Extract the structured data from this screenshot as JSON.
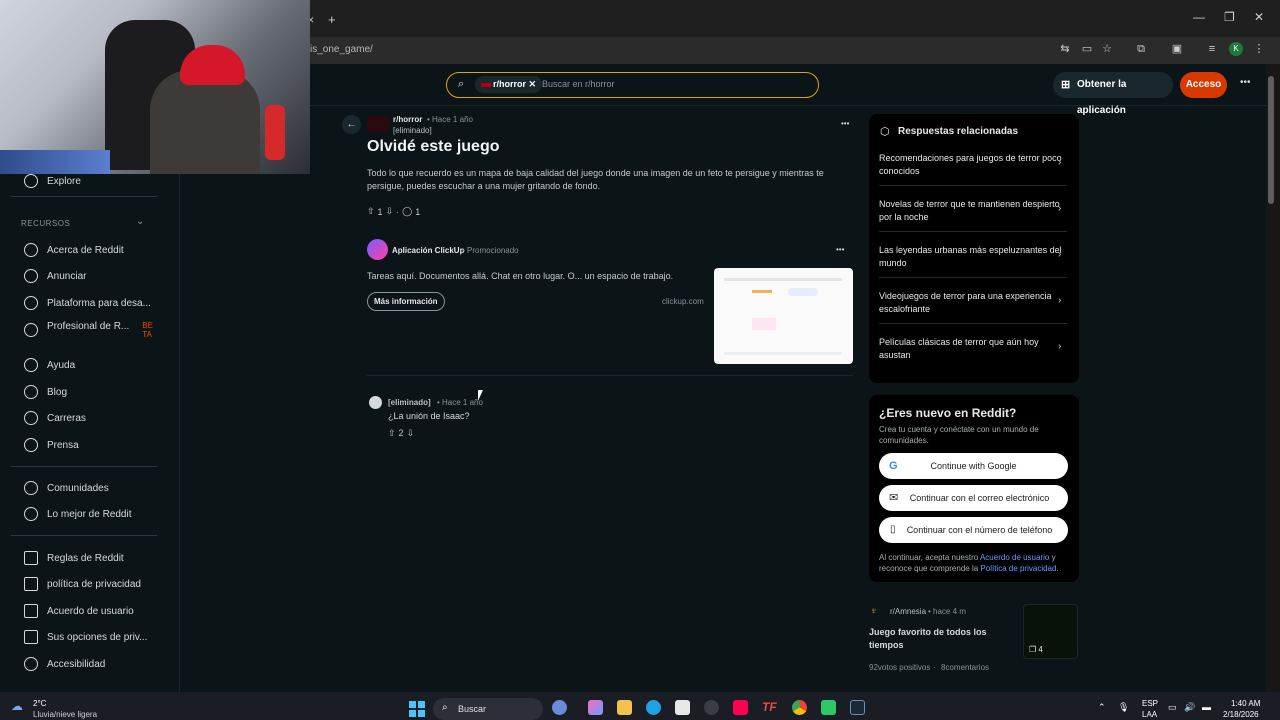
{
  "browser": {
    "url_fragment": "is_one_game/",
    "new_tab_glyph": "+",
    "close_tab_glyph": "✕",
    "win_min": "—",
    "win_max": "❐",
    "win_close": "✕",
    "toolbar_icons": [
      "translate-icon",
      "cast-icon",
      "star-icon",
      "extensions-icon",
      "sidepanel-icon",
      "media-icon",
      "profile-icon",
      "menu-icon"
    ],
    "profile_letter": "K"
  },
  "header": {
    "search_chip": "r/horror",
    "search_placeholder": "Buscar en r/horror",
    "get_app": "Obtener la aplicación",
    "login": "Acceso"
  },
  "sidebar": {
    "explore": "Explore",
    "resources_header": "RECURSOS",
    "items": [
      {
        "label": "Acerca de Reddit",
        "icon": "reddit-alien-icon"
      },
      {
        "label": "Anunciar",
        "icon": "megaphone-icon"
      },
      {
        "label": "Plataforma para desa...",
        "icon": "developer-platform-icon"
      },
      {
        "label": "Profesional de R...",
        "icon": "pro-icon",
        "badge": "BETA"
      },
      {
        "label": "Ayuda",
        "icon": "help-icon"
      },
      {
        "label": "Blog",
        "icon": "blog-icon"
      },
      {
        "label": "Carreras",
        "icon": "briefcase-icon"
      },
      {
        "label": "Prensa",
        "icon": "press-icon"
      },
      {
        "label": "Comunidades",
        "icon": "communities-icon"
      },
      {
        "label": "Lo mejor de Reddit",
        "icon": "best-icon"
      },
      {
        "label": "Reglas de Reddit",
        "icon": "book-icon"
      },
      {
        "label": "política de privacidad",
        "icon": "book-icon"
      },
      {
        "label": "Acuerdo de usuario",
        "icon": "book-icon"
      },
      {
        "label": "Sus opciones de priv...",
        "icon": "book-icon"
      },
      {
        "label": "Accesibilidad",
        "icon": "accessibility-icon"
      }
    ]
  },
  "post": {
    "subreddit": "r/horror",
    "time": "Hace 1 año",
    "author": "[eliminado]",
    "title": "Olvidé este juego",
    "body": "Todo lo que recuerdo es un mapa de baja calidad del juego donde una imagen de un feto te persigue y mientras te persigue, puedes escuchar a una mujer gritando de fondo.",
    "votes": "1",
    "comments": "1",
    "more": "•••"
  },
  "promo": {
    "name": "Aplicación ClickUp",
    "tag": "Promocionado",
    "text": "Tareas aquí. Documentos allá. Chat en otro lugar. O... un espacio de trabajo.",
    "cta": "Más información",
    "domain": "clickup.com",
    "more": "•••"
  },
  "comment": {
    "author": "[eliminado]",
    "time": "Hace 1 año",
    "text": "¿La unión de Isaac?",
    "votes": "2"
  },
  "related": {
    "title": "Respuestas relacionadas",
    "items": [
      "Recomendaciones para juegos de terror poco conocidos",
      "Novelas de terror que te mantienen despierto por la noche",
      "Las leyendas urbanas más espeluznantes del mundo",
      "Videojuegos de terror para una experiencia escalofriante",
      "Películas clásicas de terror que aún hoy asustan"
    ]
  },
  "signup": {
    "title": "¿Eres nuevo en Reddit?",
    "subtitle": "Crea tu cuenta y conéctate con un mundo de comunidades.",
    "google": "Continue with Google",
    "email": "Continuar con el correo electrónico",
    "phone": "Continuar con el número de teléfono",
    "legal_1": "Al continuar, acepta nuestro ",
    "legal_link1": "Acuerdo de usuario",
    "legal_2": " y reconoce que comprende la ",
    "legal_link2": "Política de privacidad",
    "legal_3": "."
  },
  "recommended": {
    "subreddit": "r/Amnesia",
    "time": "hace 4 m",
    "title": "Juego favorito de todos los tiempos",
    "votes": "92votos positivos",
    "comments": "8comentarios",
    "thumb_count": "4"
  },
  "taskbar": {
    "weather_temp": "2°C",
    "weather_desc": "Lluvia/nieve ligera",
    "search": "Buscar",
    "lang1": "ESP",
    "lang2": "LAA",
    "time": "1:40 AM",
    "date": "2/18/2026"
  },
  "colors": {
    "accent_orange": "#d93900",
    "link_blue": "#6a9bff",
    "search_border": "#d9a31a"
  }
}
